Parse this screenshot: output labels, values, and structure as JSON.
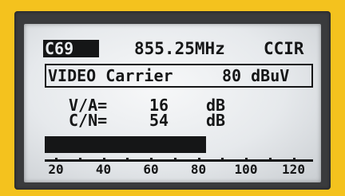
{
  "header": {
    "channel": "C69",
    "frequency": "855.25MHz",
    "standard": "CCIR"
  },
  "carrier": {
    "label": "VIDEO Carrier",
    "value": "80 dBuV"
  },
  "measurements": [
    {
      "label": "V/A=",
      "value": "16",
      "unit": "dB"
    },
    {
      "label": "C/N=",
      "value": "54",
      "unit": "dB"
    }
  ],
  "level_bar": {
    "value_fraction": 0.6,
    "scale_labels": [
      "20",
      "40",
      "60",
      "80",
      "100",
      "120"
    ]
  },
  "colors": {
    "frame": "#f4c21e",
    "bezel": "#3a3b3d",
    "lcd_background": "#e9ecef",
    "lcd_ink": "#151617"
  }
}
